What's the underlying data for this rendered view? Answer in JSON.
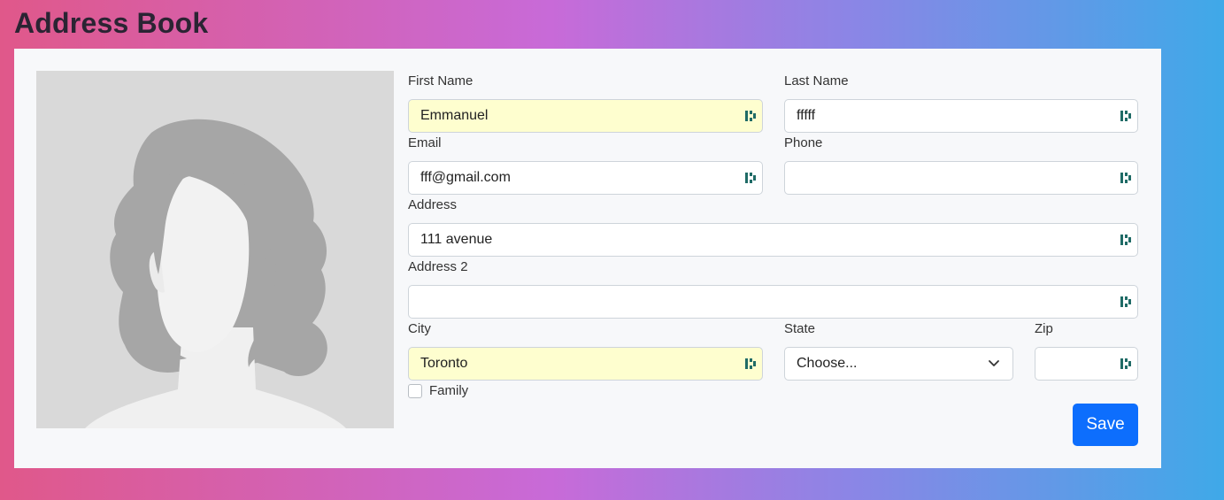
{
  "app": {
    "title": "Address Book"
  },
  "form": {
    "first_name": {
      "label": "First Name",
      "value": "Emmanuel"
    },
    "last_name": {
      "label": "Last Name",
      "value": "fffff"
    },
    "email": {
      "label": "Email",
      "value": "fff@gmail.com"
    },
    "phone": {
      "label": "Phone",
      "value": ""
    },
    "address": {
      "label": "Address",
      "value": "111 avenue"
    },
    "address2": {
      "label": "Address 2",
      "value": ""
    },
    "city": {
      "label": "City",
      "value": "Toronto"
    },
    "state": {
      "label": "State",
      "selected": "Choose..."
    },
    "zip": {
      "label": "Zip",
      "value": ""
    },
    "family": {
      "label": "Family",
      "checked": false
    },
    "save_label": "Save"
  },
  "icons": {
    "field_extension": "password-manager-icon",
    "select_arrow": "chevron-down-icon",
    "avatar": "person-silhouette"
  },
  "colors": {
    "primary": "#0d6efd",
    "autofill": "#fefecf",
    "card": "#f7f8fa"
  }
}
